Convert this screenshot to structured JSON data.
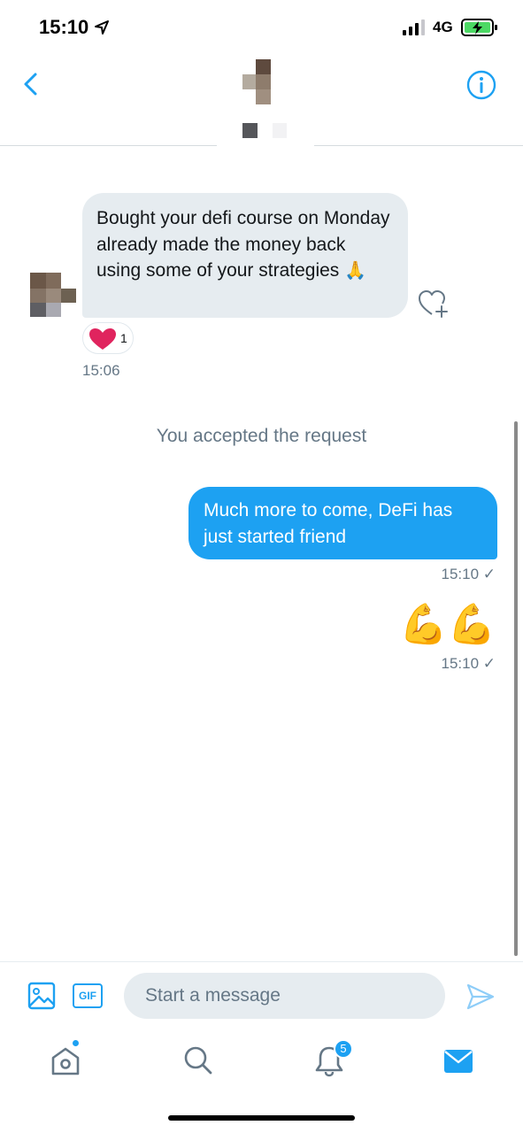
{
  "status_bar": {
    "time": "15:10",
    "network": "4G"
  },
  "header": {
    "back_icon": "chevron-left-icon",
    "info_icon": "info-circle-icon"
  },
  "conversation": {
    "incoming_message": {
      "text": "Bought your defi course on Monday already made the money back using some of your strategies",
      "emoji": "🙏",
      "reaction_count": "1",
      "timestamp": "15:06"
    },
    "system_note": "You accepted the request",
    "outgoing_messages": [
      {
        "text": "Much more to come, DeFi has just started friend",
        "timestamp": "15:10 ✓"
      },
      {
        "text": "💪💪",
        "timestamp": "15:10 ✓"
      }
    ]
  },
  "composer": {
    "gif_label": "GIF",
    "placeholder": "Start a message"
  },
  "tabbar": {
    "notifications_badge": "5"
  },
  "colors": {
    "accent": "#1da1f2",
    "incoming_bubble": "#e6ecf0",
    "secondary_text": "#657786",
    "heart": "#e0245e"
  }
}
